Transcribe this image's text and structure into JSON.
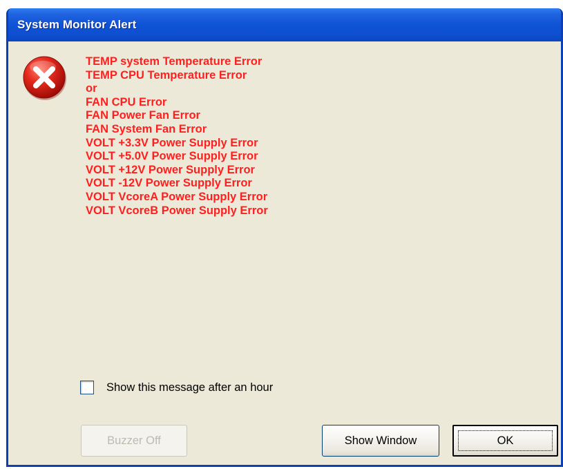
{
  "window": {
    "title": "System Monitor Alert"
  },
  "icon": {
    "name": "error-icon",
    "color": "#d31414"
  },
  "messages": [
    "TEMP system Temperature Error",
    "TEMP CPU Temperature Error",
    "or",
    "FAN CPU Error",
    "FAN Power Fan Error",
    "FAN System Fan Error",
    "VOLT +3.3V Power Supply Error",
    "VOLT +5.0V Power Supply Error",
    "VOLT +12V Power Supply Error",
    "VOLT -12V Power Supply Error",
    "VOLT VcoreA Power Supply Error",
    "VOLT VcoreB Power Supply Error"
  ],
  "message_color": "#ff1f1f",
  "checkbox": {
    "label": "Show this message after an hour",
    "checked": false
  },
  "buttons": {
    "buzzer_off": "Buzzer Off",
    "buzzer_off_enabled": false,
    "show_window": "Show Window",
    "ok": "OK"
  },
  "colors": {
    "titlebar": "#0f53d6",
    "dialog_background": "#ece9d8"
  }
}
